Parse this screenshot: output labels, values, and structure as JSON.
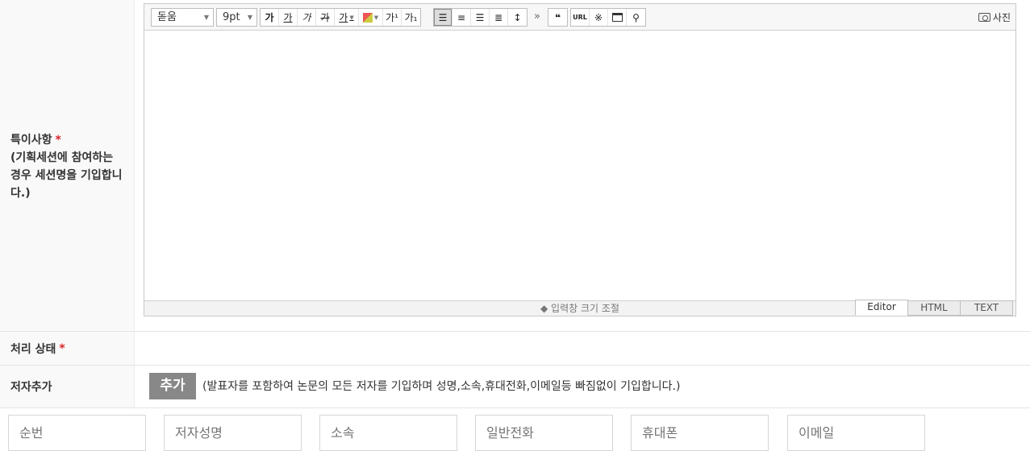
{
  "note_row": {
    "label": "특이사항",
    "required_mark": "*",
    "sub_label": "(기획세션에 참여하는 경우 세션명을 기입합니다.)"
  },
  "editor": {
    "font_family": "돋움",
    "font_size": "9pt",
    "buttons": {
      "bold": "가",
      "underline": "가",
      "italic": "가",
      "strike": "가",
      "font_color": "가",
      "superscript": "가¹",
      "subscript": "가₁",
      "quote": "❝",
      "url": "URL",
      "special_char": "※",
      "more": "»"
    },
    "photo_label": "사진",
    "resize_label": "◆ 입력창 크기 조절",
    "modes": [
      "Editor",
      "HTML",
      "TEXT"
    ]
  },
  "status_row": {
    "label": "처리 상태",
    "required_mark": "*"
  },
  "author_row": {
    "label": "저자추가",
    "add_button": "추가",
    "note": "(발표자를 포함하여 논문의 모든 저자를 기입하며 성명,소속,휴대전화,이메일등 빠짐없이 기입합니다.)"
  },
  "author_fields": [
    "순번",
    "저자성명",
    "소속",
    "일반전화",
    "휴대폰",
    "이메일"
  ]
}
